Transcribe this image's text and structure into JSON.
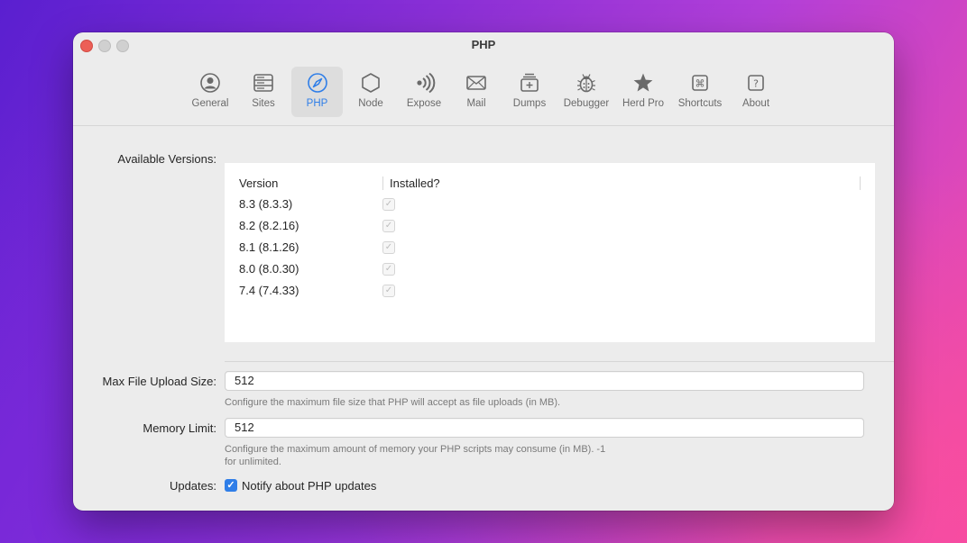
{
  "window": {
    "title": "PHP"
  },
  "toolbar": {
    "tabs": [
      {
        "label": "General",
        "icon": "person-circle-icon"
      },
      {
        "label": "Sites",
        "icon": "server-stack-icon"
      },
      {
        "label": "PHP",
        "icon": "compass-icon",
        "active": true
      },
      {
        "label": "Node",
        "icon": "hexagon-icon"
      },
      {
        "label": "Expose",
        "icon": "broadcast-waves-icon"
      },
      {
        "label": "Mail",
        "icon": "envelope-icon"
      },
      {
        "label": "Dumps",
        "icon": "tray-stack-icon"
      },
      {
        "label": "Debugger",
        "icon": "ladybug-icon"
      },
      {
        "label": "Herd Pro",
        "icon": "star-icon"
      },
      {
        "label": "Shortcuts",
        "icon": "command-key-icon"
      },
      {
        "label": "About",
        "icon": "question-square-icon"
      }
    ]
  },
  "versions": {
    "label": "Available Versions:",
    "columns": [
      "Version",
      "Installed?"
    ],
    "rows": [
      {
        "version": "8.3 (8.3.3)",
        "installed": true
      },
      {
        "version": "8.2 (8.2.16)",
        "installed": true
      },
      {
        "version": "8.1 (8.1.26)",
        "installed": true
      },
      {
        "version": "8.0 (8.0.30)",
        "installed": true
      },
      {
        "version": "7.4 (7.4.33)",
        "installed": true
      }
    ]
  },
  "upload": {
    "label": "Max File Upload Size:",
    "value": "512",
    "help": "Configure the maximum file size that PHP will accept as file uploads (in MB)."
  },
  "memory": {
    "label": "Memory Limit:",
    "value": "512",
    "help": "Configure the maximum amount of memory your PHP scripts may consume (in MB). -1 for unlimited."
  },
  "updates": {
    "label": "Updates:",
    "checkbox_label": "Notify about PHP updates",
    "checked": true
  },
  "colors": {
    "accent": "#2f7ee8",
    "close": "#ec5f57"
  }
}
